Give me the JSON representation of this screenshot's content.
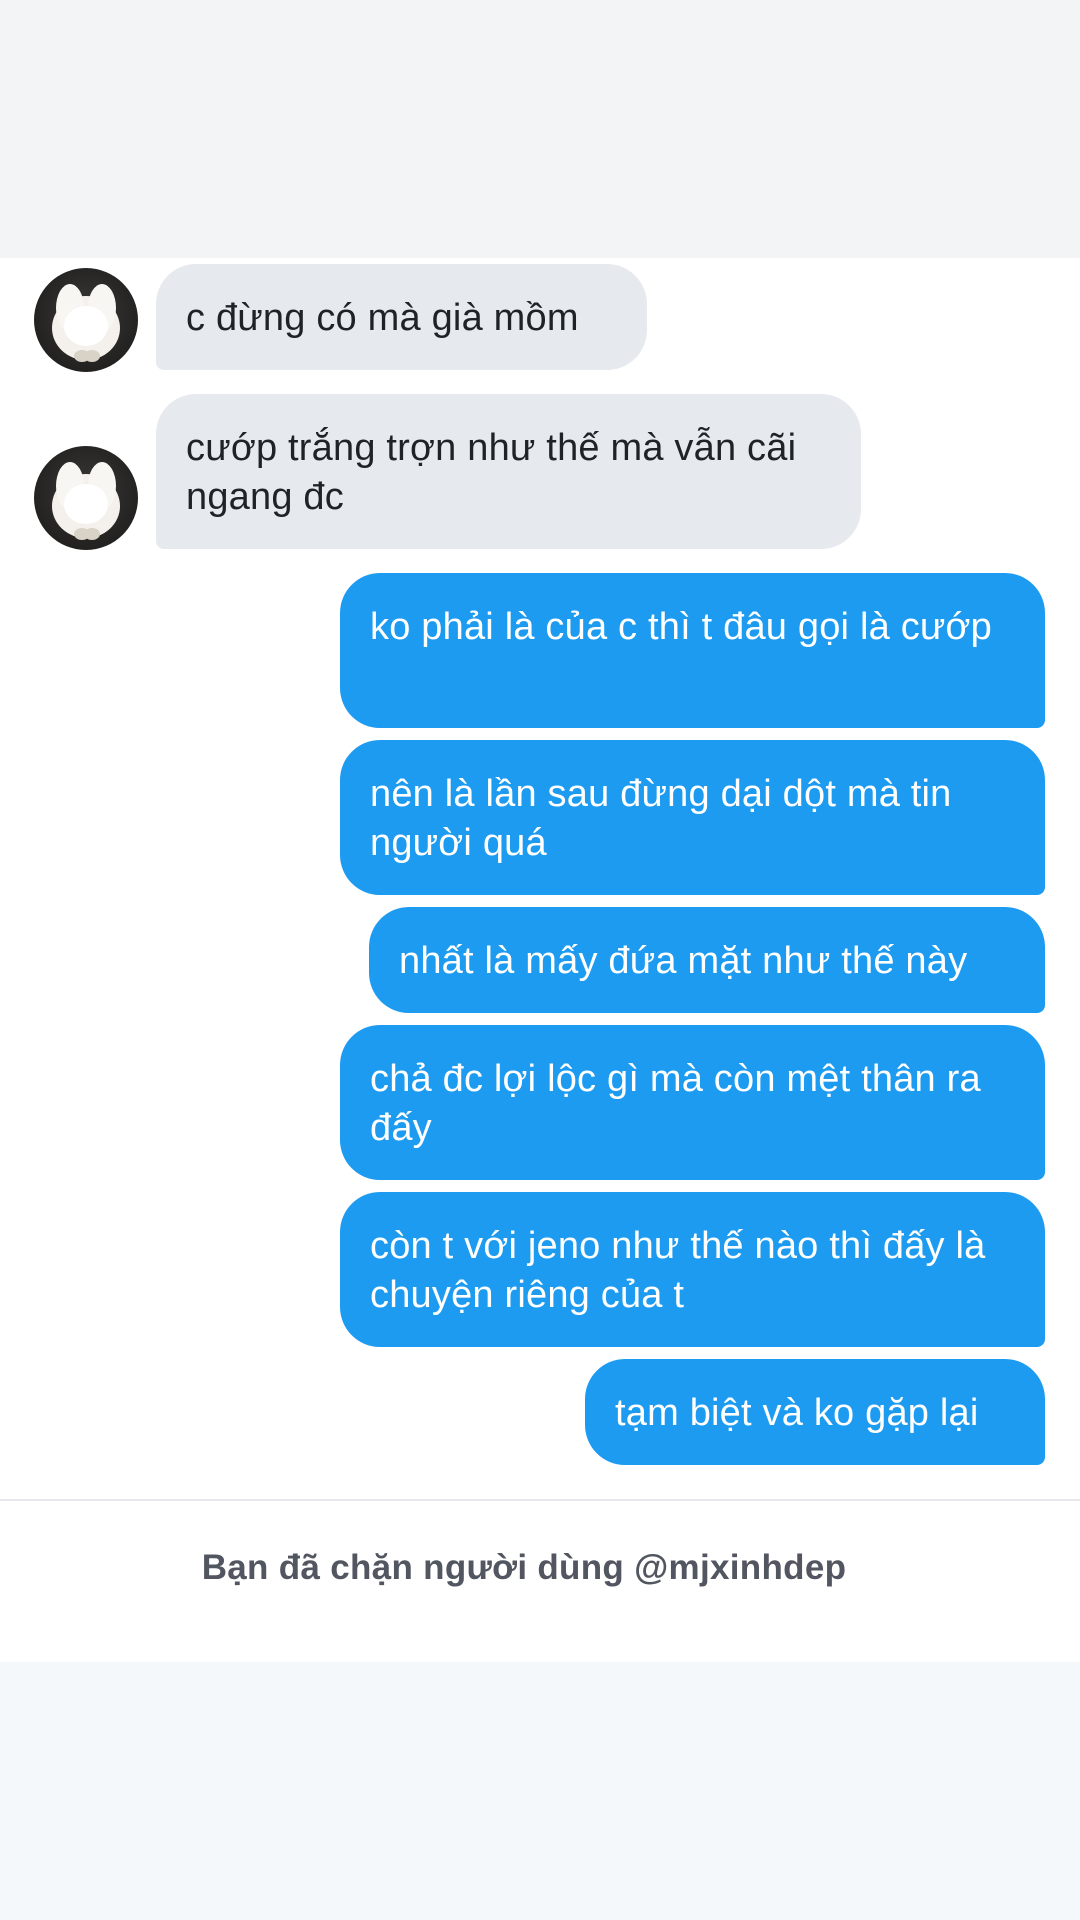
{
  "conversation": {
    "messages": [
      {
        "direction": "incoming",
        "text": "c đừng có mà già mồm"
      },
      {
        "direction": "incoming",
        "text": "cướp trắng trợn như thế mà vẫn cãi ngang đc"
      },
      {
        "direction": "outgoing",
        "text": "ko phải là của c thì t đâu gọi là cướp"
      },
      {
        "direction": "outgoing",
        "text": "nên là lần sau đừng dại dột mà tin người quá"
      },
      {
        "direction": "outgoing",
        "text": "nhất là mấy đứa mặt như thế này"
      },
      {
        "direction": "outgoing",
        "text": "chả đc lợi lộc gì mà còn mệt thân ra đấy"
      },
      {
        "direction": "outgoing",
        "text": "còn t với jeno như thế nào thì đấy là chuyện riêng của t"
      },
      {
        "direction": "outgoing",
        "text": "tạm biệt và ko gặp lại"
      }
    ],
    "avatar_icon": "white-rabbit-avatar"
  },
  "footer": {
    "blocked_notice": "Bạn đã chặn người dùng @mjxinhdep"
  },
  "colors": {
    "outgoing_bubble": "#1d9bf0",
    "incoming_bubble": "#e6e9ed",
    "top_band": "#f3f4f6",
    "bottom_band": "#f5f8fb"
  }
}
